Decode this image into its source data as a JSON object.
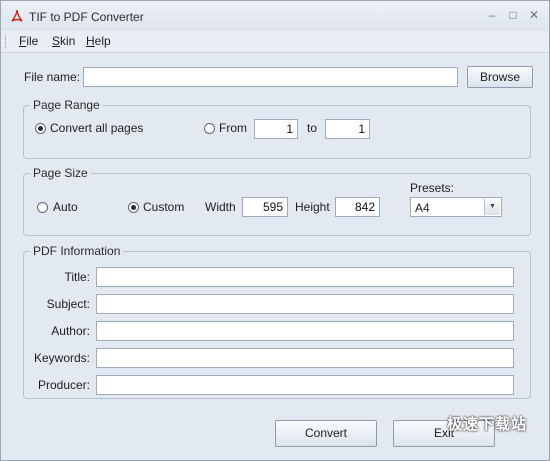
{
  "window": {
    "title": "TIF to PDF Converter",
    "controls": {
      "minimize": "–",
      "maximize": "□",
      "close": "✕"
    }
  },
  "menu": {
    "items": [
      "File",
      "Skin",
      "Help"
    ]
  },
  "file": {
    "label": "File name:",
    "value": "",
    "browse": "Browse"
  },
  "page_range": {
    "legend": "Page Range",
    "convert_all": "Convert all pages",
    "convert_all_selected": true,
    "from_label": "From",
    "from_value": "1",
    "to_label": "to",
    "to_value": "1"
  },
  "page_size": {
    "legend": "Page Size",
    "auto": "Auto",
    "custom": "Custom",
    "selected": "Custom",
    "width_label": "Width",
    "width_value": "595",
    "height_label": "Height",
    "height_value": "842",
    "presets_label": "Presets:",
    "presets_value": "A4"
  },
  "pdf_info": {
    "legend": "PDF Information",
    "fields": [
      {
        "label": "Title:",
        "value": ""
      },
      {
        "label": "Subject:",
        "value": ""
      },
      {
        "label": "Author:",
        "value": ""
      },
      {
        "label": "Keywords:",
        "value": ""
      },
      {
        "label": "Producer:",
        "value": ""
      }
    ]
  },
  "actions": {
    "convert": "Convert",
    "exit": "Exit"
  },
  "watermark": "极速下载站",
  "colors": {
    "background": "#e3e9f1",
    "border": "#b6c2d2",
    "pdf_icon": "#cc2222"
  }
}
